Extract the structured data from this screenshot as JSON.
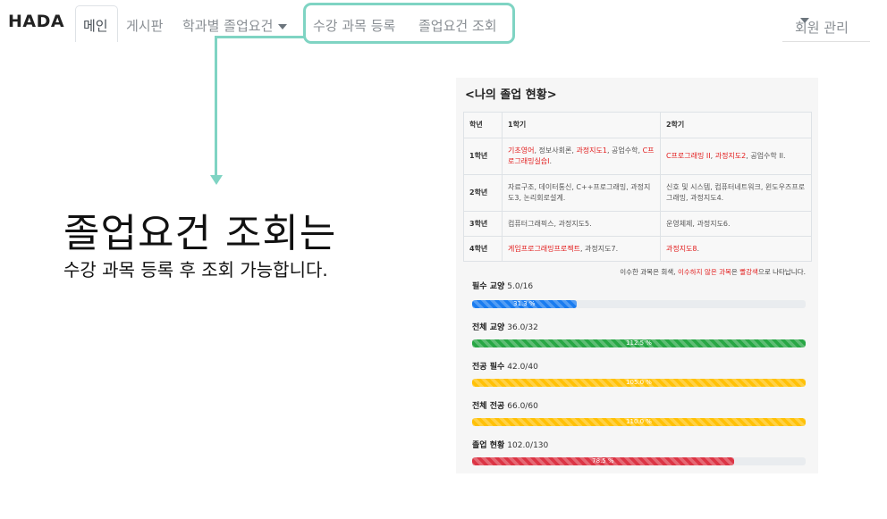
{
  "nav": {
    "brand": "HADA",
    "active": "메인",
    "board": "게시판",
    "requirements": "학과별 졸업요건",
    "register": "수강 과목 등록",
    "inquiry": "졸업요건 조회",
    "user_menu": "회원 관리"
  },
  "callout": {
    "title": "졸업요건 조회는",
    "subtitle": "수강 과목 등록 후 조회 가능합니다."
  },
  "panel": {
    "title": "<나의 졸업 현황>",
    "headers": [
      "학년",
      "1학기",
      "2학기"
    ],
    "rows": [
      {
        "year": "1학년",
        "s1": [
          {
            "t": "기초영어",
            "red": true
          },
          {
            "t": ", 정보사회론, "
          },
          {
            "t": "과정지도1",
            "red": true
          },
          {
            "t": ", 공업수학, "
          },
          {
            "t": "C프로그래밍실습I",
            "red": true
          },
          {
            "t": "."
          }
        ],
        "s2": [
          {
            "t": "C프로그래밍 II",
            "red": true
          },
          {
            "t": ", "
          },
          {
            "t": "과정지도2",
            "red": true
          },
          {
            "t": ", 공업수학 II."
          }
        ]
      },
      {
        "year": "2학년",
        "s1": [
          {
            "t": "자료구조, 데이터통신, C++프로그래밍, 과정지도3, 논리회로설계."
          }
        ],
        "s2": [
          {
            "t": "신호 및 시스템, 컴퓨터네트워크, 윈도우즈프로그래밍, 과정지도4."
          }
        ]
      },
      {
        "year": "3학년",
        "s1": [
          {
            "t": "컴퓨터그래픽스, 과정지도5."
          }
        ],
        "s2": [
          {
            "t": "운영체제, 과정지도6."
          }
        ]
      },
      {
        "year": "4학년",
        "s1": [
          {
            "t": "게임프로그래밍프로젝트",
            "red": true
          },
          {
            "t": ", 과정지도7."
          }
        ],
        "s2": [
          {
            "t": "과정지도8",
            "red": true
          },
          {
            "t": "."
          }
        ]
      }
    ],
    "note": [
      {
        "t": "이수한 과목은 회색, "
      },
      {
        "t": "이수하지 않은 과목",
        "red": true
      },
      {
        "t": "은 "
      },
      {
        "t": "빨강색",
        "red": true
      },
      {
        "t": "으로 나타납니다."
      }
    ],
    "metrics": [
      {
        "label": "필수 교양",
        "value": "5.0/16",
        "percent": 31.3,
        "percent_text": "31.3 %",
        "color": "#1a7cf0"
      },
      {
        "label": "전체 교양",
        "value": "36.0/32",
        "percent": 100,
        "percent_text": "112.5 %",
        "color": "#28a745"
      },
      {
        "label": "전공 필수",
        "value": "42.0/40",
        "percent": 100,
        "percent_text": "105.0 %",
        "color": "#ffc107"
      },
      {
        "label": "전체 전공",
        "value": "66.0/60",
        "percent": 100,
        "percent_text": "110.0 %",
        "color": "#ffc107"
      },
      {
        "label": "졸업 현황",
        "value": "102.0/130",
        "percent": 78.5,
        "percent_text": "78.5 %",
        "color": "#dc3545"
      }
    ]
  }
}
